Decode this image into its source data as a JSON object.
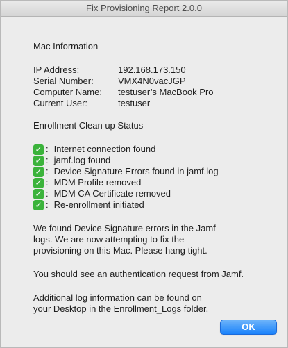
{
  "window": {
    "title": "Fix Provisioning Report 2.0.0"
  },
  "mac_info": {
    "heading": "Mac Information",
    "rows": [
      {
        "label": "IP Address:",
        "value": "192.168.173.150"
      },
      {
        "label": "Serial Number:",
        "value": "VMX4N0vacJGP"
      },
      {
        "label": "Computer Name:",
        "value": "testuser’s MacBook Pro"
      },
      {
        "label": "Current User:",
        "value": "testuser"
      }
    ]
  },
  "enrollment": {
    "heading": "Enrollment Clean up Status",
    "items": [
      {
        "icon": "check-mark-icon",
        "text": "Internet connection found"
      },
      {
        "icon": "check-mark-icon",
        "text": "jamf.log found"
      },
      {
        "icon": "check-mark-icon",
        "text": "Device Signature Errors found in jamf.log"
      },
      {
        "icon": "check-mark-icon",
        "text": "MDM Profile removed"
      },
      {
        "icon": "check-mark-icon",
        "text": "MDM CA Certificate removed"
      },
      {
        "icon": "check-mark-icon",
        "text": "Re-enrollment initiated"
      }
    ]
  },
  "messages": {
    "p1": "We found Device Signature errors in the Jamf\nlogs. We are now attempting to fix the\nprovisioning on this Mac. Please hang tight.",
    "p2": "You should see an authentication request from Jamf.",
    "p3": "Additional log information can be found on\nyour Desktop in the Enrollment_Logs folder."
  },
  "buttons": {
    "ok": "OK"
  },
  "colors": {
    "check": "#3bb33b",
    "button": "#1a82fb"
  }
}
